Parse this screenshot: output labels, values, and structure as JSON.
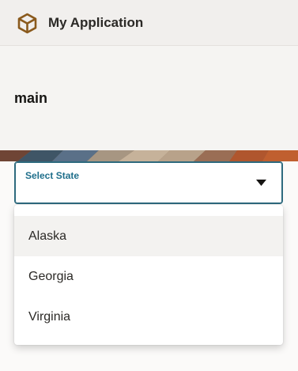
{
  "header": {
    "title": "My Application",
    "logo_icon": "cube-icon",
    "logo_color": "#8a5a1d"
  },
  "page": {
    "title": "main"
  },
  "select": {
    "label": "Select State",
    "accent_color": "#1f6f8b",
    "arrow_icon": "caret-down-icon",
    "options": [
      "Alaska",
      "Georgia",
      "Virginia"
    ],
    "highlighted_option": "Alaska"
  }
}
